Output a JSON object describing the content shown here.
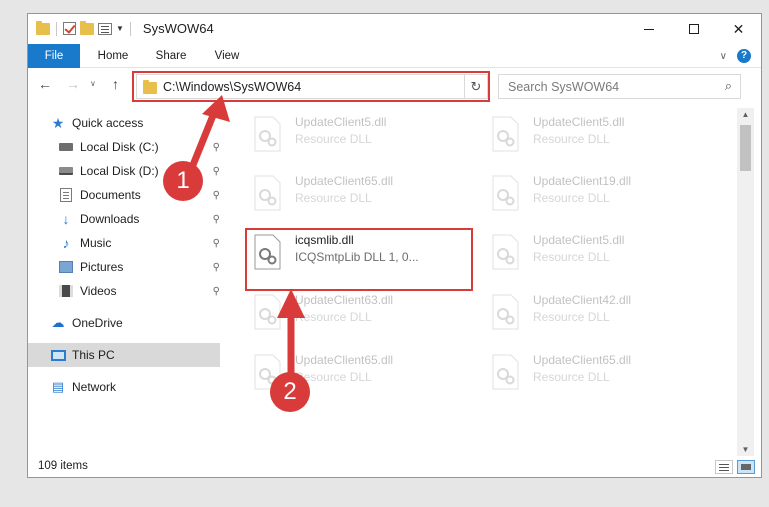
{
  "window": {
    "title": "SysWOW64",
    "controls": {
      "minimize": "minimize-icon",
      "maximize": "maximize-icon",
      "close": "✕"
    }
  },
  "ribbon": {
    "tabs": [
      "File",
      "Home",
      "Share",
      "View"
    ],
    "help": "?",
    "collapse": "∨"
  },
  "navigation": {
    "back": "←",
    "forward": "→",
    "recent": "∨",
    "up": "↑",
    "address": "C:\\Windows\\SysWOW64",
    "address_dropdown": "∨",
    "refresh": "↻",
    "search_placeholder": "Search SysWOW64",
    "search_icon": "⌕"
  },
  "sidebar": {
    "items": [
      {
        "label": "Quick access",
        "icon": "star-icon",
        "pinned": false
      },
      {
        "label": "Local Disk (C:)",
        "icon": "drive-icon",
        "pinned": true
      },
      {
        "label": "Local Disk (D:)",
        "icon": "drive-icon",
        "pinned": true
      },
      {
        "label": "Documents",
        "icon": "documents-icon",
        "pinned": true
      },
      {
        "label": "Downloads",
        "icon": "download-icon",
        "pinned": true
      },
      {
        "label": "Music",
        "icon": "music-icon",
        "pinned": true
      },
      {
        "label": "Pictures",
        "icon": "pictures-icon",
        "pinned": true
      },
      {
        "label": "Videos",
        "icon": "videos-icon",
        "pinned": true
      },
      {
        "label": "OneDrive",
        "icon": "onedrive-icon",
        "pinned": false
      },
      {
        "label": "This PC",
        "icon": "pc-icon",
        "pinned": false,
        "selected": true
      },
      {
        "label": "Network",
        "icon": "network-icon",
        "pinned": false
      }
    ],
    "pin_glyph": "📌"
  },
  "files": [
    {
      "name": "UpdateClient5.dll",
      "desc": "Resource DLL",
      "faded": true
    },
    {
      "name": "UpdateClient5.dll",
      "desc": "Resource DLL",
      "faded": true
    },
    {
      "name": "UpdateClient65.dll",
      "desc": "Resource DLL",
      "faded": true
    },
    {
      "name": "UpdateClient19.dll",
      "desc": "Resource DLL",
      "faded": true
    },
    {
      "name": "icqsmlib.dll",
      "desc": "ICQSmtpLib DLL 1, 0...",
      "faded": false,
      "highlighted": true
    },
    {
      "name": "UpdateClient5.dll",
      "desc": "Resource DLL",
      "faded": true
    },
    {
      "name": "UpdateClient63.dll",
      "desc": "Resource DLL",
      "faded": true
    },
    {
      "name": "UpdateClient42.dll",
      "desc": "Resource DLL",
      "faded": true
    },
    {
      "name": "UpdateClient65.dll",
      "desc": "Resource DLL",
      "faded": true
    },
    {
      "name": "UpdateClient65.dll",
      "desc": "Resource DLL",
      "faded": true
    }
  ],
  "status": {
    "item_count": "109 items"
  },
  "annotations": {
    "callout_1": "1",
    "callout_2": "2",
    "color": "#d93a3a"
  },
  "colors": {
    "accent": "#1979ca",
    "highlight": "#d93a3a",
    "selected": "#d9d9d9"
  }
}
